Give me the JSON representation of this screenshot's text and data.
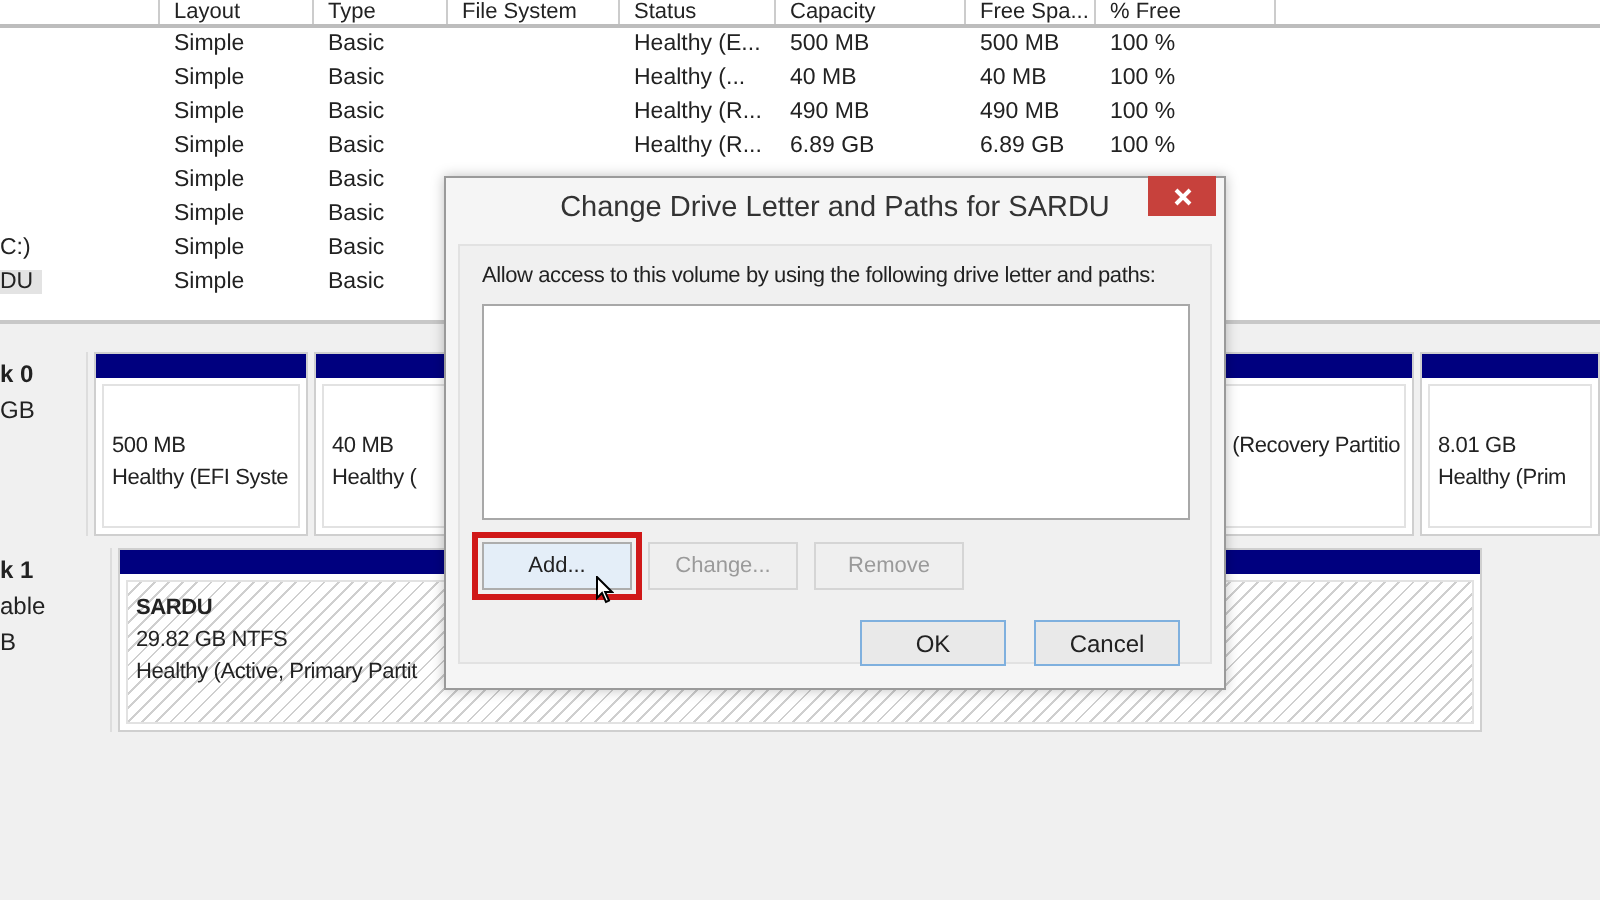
{
  "volume_list": {
    "columns": [
      "Layout",
      "Type",
      "File System",
      "Status",
      "Capacity",
      "Free Spa...",
      "% Free"
    ],
    "rows": [
      {
        "layout": "Simple",
        "type": "Basic",
        "status": "Healthy (E...",
        "capacity": "500 MB",
        "free_space": "500 MB",
        "percent_free": "100 %",
        "selected": false
      },
      {
        "layout": "Simple",
        "type": "Basic",
        "status": "Healthy (...",
        "capacity": "40 MB",
        "free_space": "40 MB",
        "percent_free": "100 %",
        "selected": false
      },
      {
        "layout": "Simple",
        "type": "Basic",
        "status": "Healthy (R...",
        "capacity": "490 MB",
        "free_space": "490 MB",
        "percent_free": "100 %",
        "selected": false
      },
      {
        "layout": "Simple",
        "type": "Basic",
        "status": "Healthy (R...",
        "capacity": "6.89 GB",
        "free_space": "6.89 GB",
        "percent_free": "100 %",
        "selected": false
      },
      {
        "layout": "Simple",
        "type": "Basic",
        "selected": false
      },
      {
        "layout": "Simple",
        "type": "Basic",
        "selected": false
      },
      {
        "volume": "C:)",
        "layout": "Simple",
        "type": "Basic",
        "selected": false
      },
      {
        "volume": "DU",
        "layout": "Simple",
        "type": "Basic",
        "selected": true
      }
    ]
  },
  "disks": [
    {
      "label_lines": [
        "k 0",
        "GB"
      ],
      "partitions": [
        {
          "lines": [
            "500 MB",
            "Healthy (EFI Syste"
          ]
        },
        {
          "lines": [
            "40 MB",
            "Healthy ("
          ]
        },
        {
          "lines": [
            "(Recovery Partitio"
          ]
        },
        {
          "lines": [
            "8.01 GB",
            "Healthy (Prim"
          ]
        }
      ]
    },
    {
      "label_lines": [
        "k 1",
        "able",
        "B"
      ],
      "partitions": [
        {
          "name": "SARDU",
          "lines": [
            "29.82 GB NTFS",
            "Healthy (Active, Primary Partit"
          ]
        }
      ]
    }
  ],
  "dialog": {
    "title": "Change Drive Letter and Paths for SARDU",
    "prompt": "Allow access to this volume by using the following drive letter and paths:",
    "buttons": [
      {
        "label": "Add...",
        "disabled": false,
        "highlighted": true
      },
      {
        "label": "Change...",
        "disabled": true,
        "highlighted": false
      },
      {
        "label": "Remove",
        "disabled": true,
        "highlighted": false
      }
    ],
    "footer_buttons": [
      "OK",
      "Cancel"
    ]
  }
}
